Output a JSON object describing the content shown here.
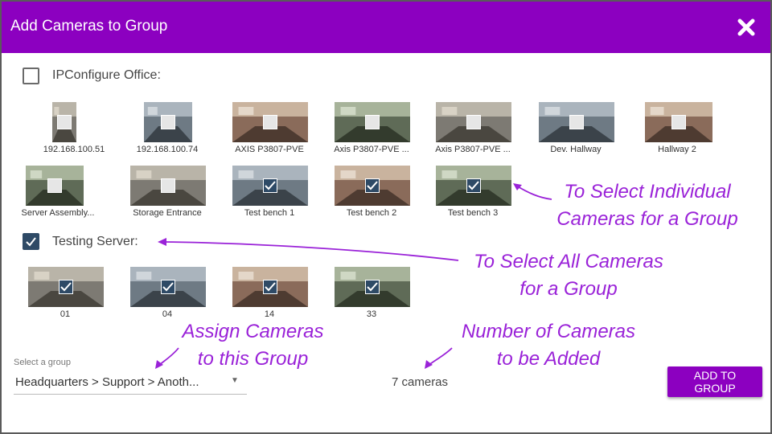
{
  "dialog": {
    "title": "Add Cameras to Group",
    "close_icon": "close-icon"
  },
  "groups": [
    {
      "name": "IPConfigure Office:",
      "checked": false,
      "cameras": [
        {
          "label": "192.168.100.51",
          "checked": false
        },
        {
          "label": "192.168.100.74",
          "checked": false
        },
        {
          "label": "AXIS P3807-PVE",
          "checked": false
        },
        {
          "label": "Axis P3807-PVE ...",
          "checked": false
        },
        {
          "label": "Axis P3807-PVE ...",
          "checked": false
        },
        {
          "label": "Dev. Hallway",
          "checked": false
        },
        {
          "label": "Hallway 2",
          "checked": false
        },
        {
          "label": "Server Assembly...",
          "checked": false
        },
        {
          "label": "Storage Entrance",
          "checked": false
        },
        {
          "label": "Test bench 1",
          "checked": true
        },
        {
          "label": "Test bench 2",
          "checked": true
        },
        {
          "label": "Test bench 3",
          "checked": true
        }
      ]
    },
    {
      "name": "Testing Server:",
      "checked": true,
      "cameras": [
        {
          "label": "01",
          "checked": true
        },
        {
          "label": "04",
          "checked": true
        },
        {
          "label": "14",
          "checked": true
        },
        {
          "label": "33",
          "checked": true
        }
      ]
    }
  ],
  "annotations": {
    "individual": [
      "To Select Individual",
      "Cameras for a Group"
    ],
    "all": [
      "To Select All Cameras",
      "for a Group"
    ],
    "assign": [
      "Assign Cameras",
      "to this Group"
    ],
    "count": [
      "Number of Cameras",
      "to be Added"
    ]
  },
  "footer": {
    "select_label": "Select a group",
    "select_value": "Headquarters > Support > Anoth...",
    "camera_count": "7 cameras",
    "add_button": "ADD TO GROUP"
  },
  "colors": {
    "header": "#8c00c0",
    "annotation": "#9a22d8",
    "checked": "#2e4a66"
  }
}
